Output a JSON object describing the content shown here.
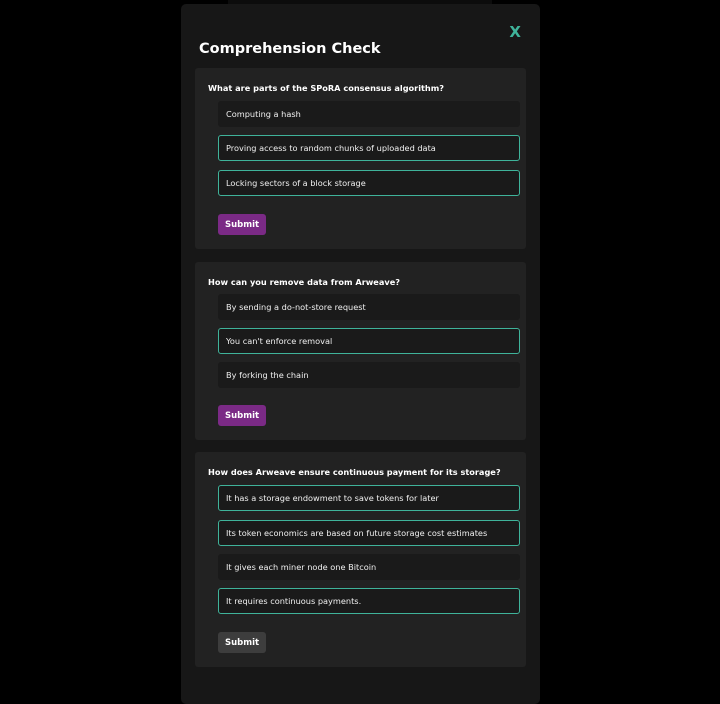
{
  "modal": {
    "title": "Comprehension Check",
    "close_label": "X"
  },
  "questions": [
    {
      "question": "What are parts of the SPoRA consensus algorithm?",
      "options": [
        {
          "label": "Computing a hash",
          "selected": false
        },
        {
          "label": "Proving access to random chunks of uploaded data",
          "selected": true
        },
        {
          "label": "Locking sectors of a block storage",
          "selected": true
        }
      ],
      "submit_label": "Submit",
      "submit_style": "active"
    },
    {
      "question": "How can you remove data from Arweave?",
      "options": [
        {
          "label": "By sending a do-not-store request",
          "selected": false
        },
        {
          "label": "You can't enforce removal",
          "selected": true
        },
        {
          "label": "By forking the chain",
          "selected": false
        }
      ],
      "submit_label": "Submit",
      "submit_style": "active"
    },
    {
      "question": "How does Arweave ensure continuous payment for its storage?",
      "options": [
        {
          "label": "It has a storage endowment to save tokens for later",
          "selected": true
        },
        {
          "label": "Its token economics are based on future storage cost estimates",
          "selected": true
        },
        {
          "label": "It gives each miner node one Bitcoin",
          "selected": false
        },
        {
          "label": "It requires continuous payments.",
          "selected": true
        }
      ],
      "submit_label": "Submit",
      "submit_style": "disabled"
    }
  ],
  "colors": {
    "accent": "#3fb39a",
    "submit_active": "#7b2a86",
    "submit_inactive": "#3d3d3d"
  }
}
